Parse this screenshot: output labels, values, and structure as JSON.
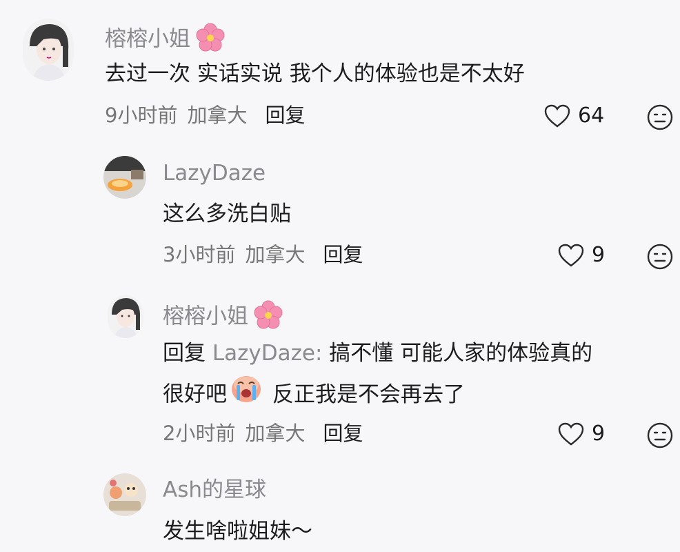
{
  "comments": [
    {
      "username": "榕榕小姐",
      "text": "去过一次 实话实说 我个人的体验也是不太好",
      "time": "9小时前",
      "location": "加拿大",
      "reply_label": "回复",
      "likes": "64"
    },
    {
      "username": "LazyDaze",
      "text": "这么多洗白贴",
      "time": "3小时前",
      "location": "加拿大",
      "reply_label": "回复",
      "likes": "9"
    },
    {
      "username": "榕榕小姐",
      "reply_prefix": "回复",
      "reply_to": "LazyDaze:",
      "text_line1": "搞不懂 可能人家的体验真的",
      "text_line2a": "很好吧",
      "text_line2b": "反正我是不会再去了",
      "time": "2小时前",
      "location": "加拿大",
      "reply_label": "回复",
      "likes": "9"
    },
    {
      "username": "Ash的星球",
      "text": "发生啥啦姐妹～"
    }
  ],
  "icons": {
    "like": "heart-outline-icon",
    "dislike": "neutral-face-icon",
    "name_badge": "pink-flower-icon",
    "inline_emoji": "crying-face-emoji"
  },
  "colors": {
    "background": "#f7f7f9",
    "username": "#8a8a8e",
    "text": "#1c1c1e",
    "flower": "#f48fb1"
  }
}
